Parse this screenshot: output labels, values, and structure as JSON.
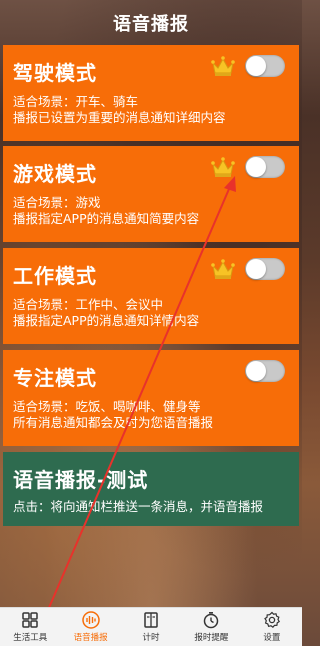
{
  "page": {
    "title": "语音播报"
  },
  "modes": [
    {
      "title": "驾驶模式",
      "scene": "适合场景：开车、骑车",
      "desc": "播报已设置为重要的消息通知详细内容",
      "crown": true,
      "enabled": false
    },
    {
      "title": "游戏模式",
      "scene": "适合场景：游戏",
      "desc": "播报指定APP的消息通知简要内容",
      "crown": true,
      "enabled": false
    },
    {
      "title": "工作模式",
      "scene": "适合场景：工作中、会议中",
      "desc": "播报指定APP的消息通知详情内容",
      "crown": true,
      "enabled": false
    },
    {
      "title": "专注模式",
      "scene": "适合场景：吃饭、喝咖啡、健身等",
      "desc": "所有消息通知都会及时为您语音播报",
      "crown": false,
      "enabled": false
    }
  ],
  "test": {
    "title": "语音播报-测试",
    "desc": "点击：将向通知栏推送一条消息，并语音播报"
  },
  "nav": [
    {
      "label": "生活工具",
      "icon": "grid-icon",
      "active": false
    },
    {
      "label": "语音播报",
      "icon": "voice-wave-icon",
      "active": true
    },
    {
      "label": "计时",
      "icon": "timer-book-icon",
      "active": false
    },
    {
      "label": "报时提醒",
      "icon": "clock-icon",
      "active": false
    },
    {
      "label": "设置",
      "icon": "gear-icon",
      "active": false
    }
  ],
  "colors": {
    "card": "#f76d08",
    "test_card": "#2e6b4f",
    "active_nav": "#f76d08",
    "annotation_arrow": "#e8322b"
  }
}
